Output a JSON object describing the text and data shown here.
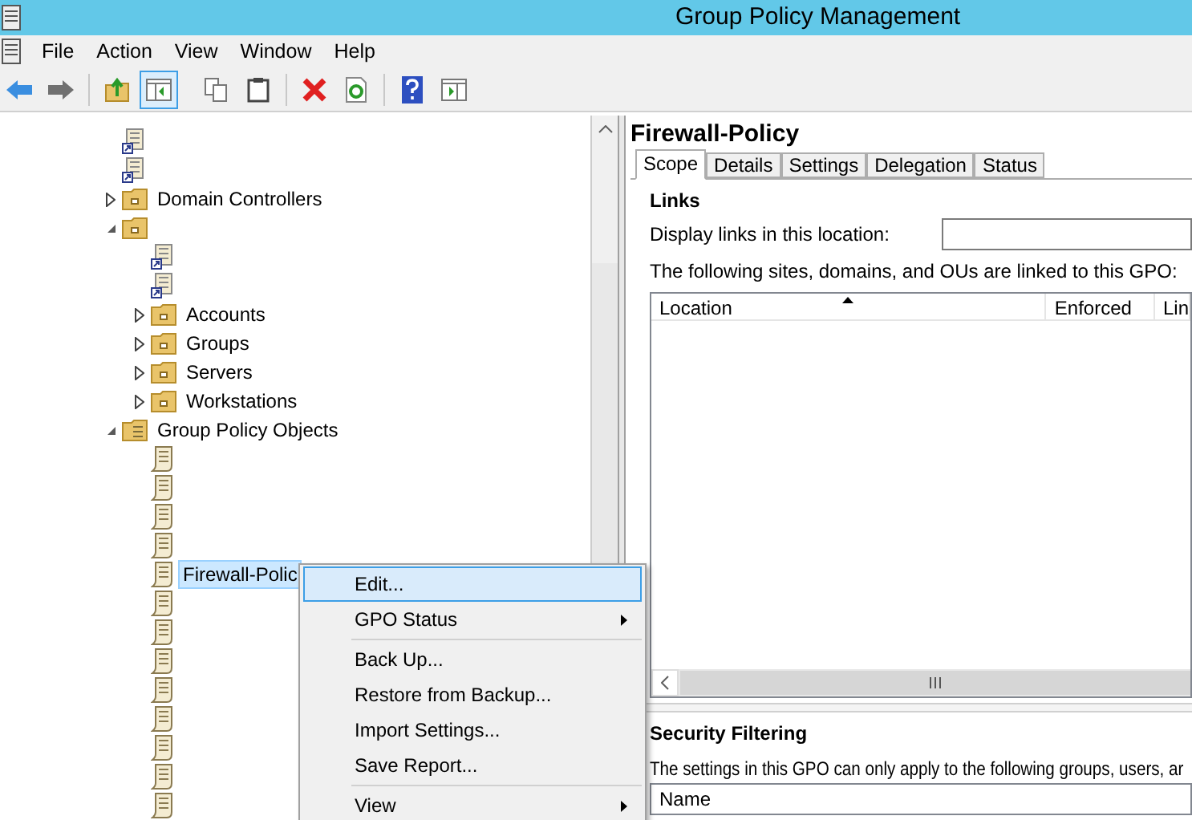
{
  "window": {
    "title": "Group Policy Management"
  },
  "menu_bar": [
    "File",
    "Action",
    "View",
    "Window",
    "Help"
  ],
  "tree": [
    {
      "kind": "link"
    },
    {
      "kind": "link"
    },
    {
      "kind": "folder",
      "label": "Domain Controllers",
      "expanded": false,
      "selected": false
    },
    {
      "kind": "folder",
      "expanded": true,
      "selected": false,
      "children": [
        {
          "kind": "link"
        },
        {
          "kind": "link"
        },
        {
          "kind": "folder",
          "label": "Accounts",
          "expanded": false,
          "selected": false
        },
        {
          "kind": "folder",
          "label": "Groups",
          "expanded": false,
          "selected": false
        },
        {
          "kind": "folder",
          "label": "Servers",
          "expanded": false,
          "selected": false
        },
        {
          "kind": "folder",
          "label": "Workstations",
          "expanded": false,
          "selected": false
        }
      ]
    },
    {
      "kind": "gpo-folder",
      "label": "Group Policy Objects",
      "expanded": true,
      "selected": false,
      "children": [
        {
          "kind": "gpo",
          "selected": false
        },
        {
          "kind": "gpo",
          "selected": false
        },
        {
          "kind": "gpo",
          "selected": false
        },
        {
          "kind": "gpo",
          "selected": false
        },
        {
          "kind": "gpo",
          "label": "Firewall-Polic",
          "selected": true
        },
        {
          "kind": "gpo",
          "selected": false
        },
        {
          "kind": "gpo",
          "selected": false
        },
        {
          "kind": "gpo",
          "selected": false
        },
        {
          "kind": "gpo",
          "selected": false
        },
        {
          "kind": "gpo",
          "selected": false
        },
        {
          "kind": "gpo",
          "selected": false
        },
        {
          "kind": "gpo",
          "selected": false
        },
        {
          "kind": "gpo",
          "selected": false
        }
      ]
    }
  ],
  "context_menu": [
    {
      "kind": "item",
      "label": "Edit...",
      "selected": true,
      "submenu": false
    },
    {
      "kind": "item",
      "label": "GPO Status",
      "selected": false,
      "submenu": true
    },
    {
      "kind": "separator"
    },
    {
      "kind": "item",
      "label": "Back Up...",
      "selected": false,
      "submenu": false
    },
    {
      "kind": "item",
      "label": "Restore from Backup...",
      "selected": false,
      "submenu": false
    },
    {
      "kind": "item",
      "label": "Import Settings...",
      "selected": false,
      "submenu": false
    },
    {
      "kind": "item",
      "label": "Save Report...",
      "selected": false,
      "submenu": false
    },
    {
      "kind": "separator"
    },
    {
      "kind": "item",
      "label": "View",
      "selected": false,
      "submenu": true
    }
  ],
  "details": {
    "title": "Firewall-Policy",
    "tabs": [
      {
        "label": "Scope",
        "selected": true
      },
      {
        "label": "Details",
        "selected": false
      },
      {
        "label": "Settings",
        "selected": false
      },
      {
        "label": "Delegation",
        "selected": false
      },
      {
        "label": "Status",
        "selected": false
      }
    ],
    "links": {
      "heading": "Links",
      "location_label": "Display links in this location:",
      "intro": "The following sites, domains, and OUs are linked to this GPO:",
      "columns": [
        "Location",
        "Enforced",
        "Lin"
      ]
    },
    "security_filtering": {
      "heading": "Security Filtering",
      "intro": "The settings in this GPO can only apply to the following groups, users, ar",
      "columns": [
        "Name"
      ]
    }
  }
}
